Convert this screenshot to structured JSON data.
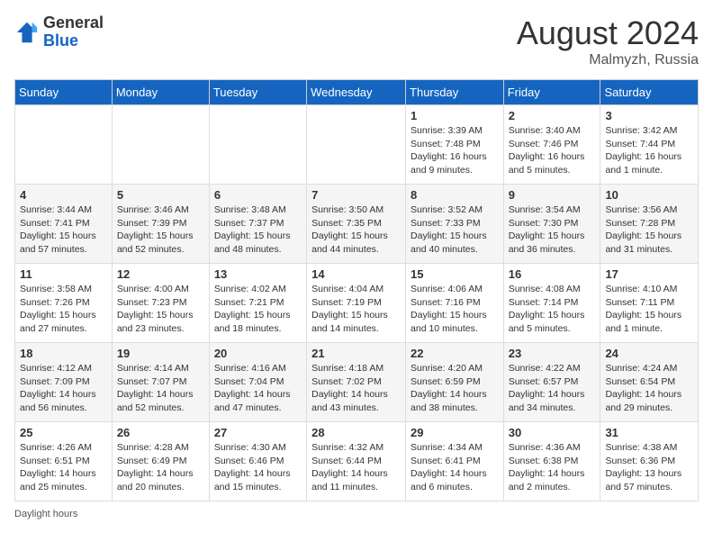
{
  "header": {
    "logo_general": "General",
    "logo_blue": "Blue",
    "month_title": "August 2024",
    "location": "Malmyzh, Russia"
  },
  "days_of_week": [
    "Sunday",
    "Monday",
    "Tuesday",
    "Wednesday",
    "Thursday",
    "Friday",
    "Saturday"
  ],
  "weeks": [
    [
      {
        "day": "",
        "info": ""
      },
      {
        "day": "",
        "info": ""
      },
      {
        "day": "",
        "info": ""
      },
      {
        "day": "",
        "info": ""
      },
      {
        "day": "1",
        "info": "Sunrise: 3:39 AM\nSunset: 7:48 PM\nDaylight: 16 hours and 9 minutes."
      },
      {
        "day": "2",
        "info": "Sunrise: 3:40 AM\nSunset: 7:46 PM\nDaylight: 16 hours and 5 minutes."
      },
      {
        "day": "3",
        "info": "Sunrise: 3:42 AM\nSunset: 7:44 PM\nDaylight: 16 hours and 1 minute."
      }
    ],
    [
      {
        "day": "4",
        "info": "Sunrise: 3:44 AM\nSunset: 7:41 PM\nDaylight: 15 hours and 57 minutes."
      },
      {
        "day": "5",
        "info": "Sunrise: 3:46 AM\nSunset: 7:39 PM\nDaylight: 15 hours and 52 minutes."
      },
      {
        "day": "6",
        "info": "Sunrise: 3:48 AM\nSunset: 7:37 PM\nDaylight: 15 hours and 48 minutes."
      },
      {
        "day": "7",
        "info": "Sunrise: 3:50 AM\nSunset: 7:35 PM\nDaylight: 15 hours and 44 minutes."
      },
      {
        "day": "8",
        "info": "Sunrise: 3:52 AM\nSunset: 7:33 PM\nDaylight: 15 hours and 40 minutes."
      },
      {
        "day": "9",
        "info": "Sunrise: 3:54 AM\nSunset: 7:30 PM\nDaylight: 15 hours and 36 minutes."
      },
      {
        "day": "10",
        "info": "Sunrise: 3:56 AM\nSunset: 7:28 PM\nDaylight: 15 hours and 31 minutes."
      }
    ],
    [
      {
        "day": "11",
        "info": "Sunrise: 3:58 AM\nSunset: 7:26 PM\nDaylight: 15 hours and 27 minutes."
      },
      {
        "day": "12",
        "info": "Sunrise: 4:00 AM\nSunset: 7:23 PM\nDaylight: 15 hours and 23 minutes."
      },
      {
        "day": "13",
        "info": "Sunrise: 4:02 AM\nSunset: 7:21 PM\nDaylight: 15 hours and 18 minutes."
      },
      {
        "day": "14",
        "info": "Sunrise: 4:04 AM\nSunset: 7:19 PM\nDaylight: 15 hours and 14 minutes."
      },
      {
        "day": "15",
        "info": "Sunrise: 4:06 AM\nSunset: 7:16 PM\nDaylight: 15 hours and 10 minutes."
      },
      {
        "day": "16",
        "info": "Sunrise: 4:08 AM\nSunset: 7:14 PM\nDaylight: 15 hours and 5 minutes."
      },
      {
        "day": "17",
        "info": "Sunrise: 4:10 AM\nSunset: 7:11 PM\nDaylight: 15 hours and 1 minute."
      }
    ],
    [
      {
        "day": "18",
        "info": "Sunrise: 4:12 AM\nSunset: 7:09 PM\nDaylight: 14 hours and 56 minutes."
      },
      {
        "day": "19",
        "info": "Sunrise: 4:14 AM\nSunset: 7:07 PM\nDaylight: 14 hours and 52 minutes."
      },
      {
        "day": "20",
        "info": "Sunrise: 4:16 AM\nSunset: 7:04 PM\nDaylight: 14 hours and 47 minutes."
      },
      {
        "day": "21",
        "info": "Sunrise: 4:18 AM\nSunset: 7:02 PM\nDaylight: 14 hours and 43 minutes."
      },
      {
        "day": "22",
        "info": "Sunrise: 4:20 AM\nSunset: 6:59 PM\nDaylight: 14 hours and 38 minutes."
      },
      {
        "day": "23",
        "info": "Sunrise: 4:22 AM\nSunset: 6:57 PM\nDaylight: 14 hours and 34 minutes."
      },
      {
        "day": "24",
        "info": "Sunrise: 4:24 AM\nSunset: 6:54 PM\nDaylight: 14 hours and 29 minutes."
      }
    ],
    [
      {
        "day": "25",
        "info": "Sunrise: 4:26 AM\nSunset: 6:51 PM\nDaylight: 14 hours and 25 minutes."
      },
      {
        "day": "26",
        "info": "Sunrise: 4:28 AM\nSunset: 6:49 PM\nDaylight: 14 hours and 20 minutes."
      },
      {
        "day": "27",
        "info": "Sunrise: 4:30 AM\nSunset: 6:46 PM\nDaylight: 14 hours and 15 minutes."
      },
      {
        "day": "28",
        "info": "Sunrise: 4:32 AM\nSunset: 6:44 PM\nDaylight: 14 hours and 11 minutes."
      },
      {
        "day": "29",
        "info": "Sunrise: 4:34 AM\nSunset: 6:41 PM\nDaylight: 14 hours and 6 minutes."
      },
      {
        "day": "30",
        "info": "Sunrise: 4:36 AM\nSunset: 6:38 PM\nDaylight: 14 hours and 2 minutes."
      },
      {
        "day": "31",
        "info": "Sunrise: 4:38 AM\nSunset: 6:36 PM\nDaylight: 13 hours and 57 minutes."
      }
    ]
  ],
  "footer": {
    "daylight_label": "Daylight hours"
  }
}
